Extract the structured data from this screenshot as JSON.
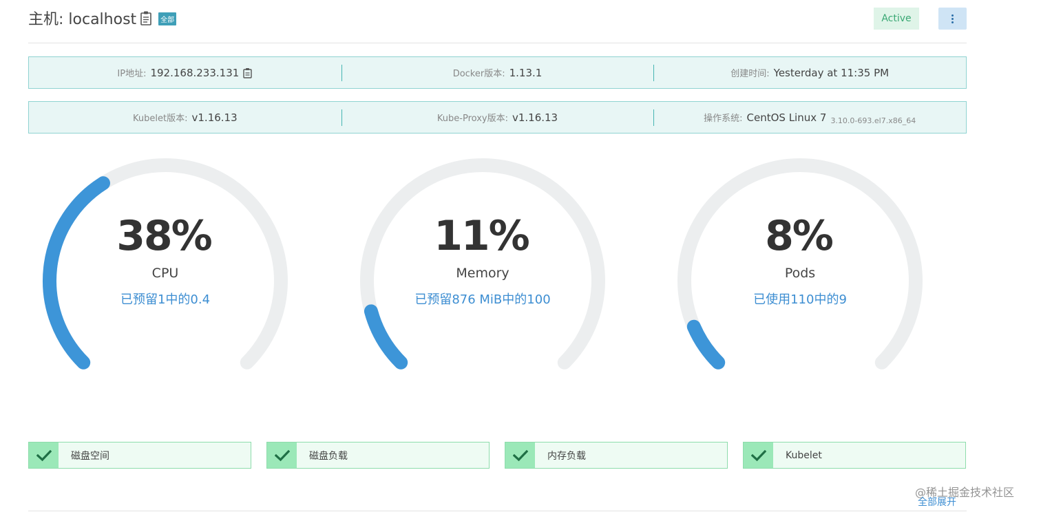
{
  "header": {
    "title": "主机: localhost",
    "scope_badge": "全部",
    "status": "Active",
    "status_color": "#3aa874",
    "more_icon": "vertical-dots-icon"
  },
  "info_rows": [
    {
      "cells": [
        {
          "label": "IP地址:",
          "value": "192.168.233.131",
          "icon": "copy-icon"
        },
        {
          "label": "Docker版本:",
          "value": "1.13.1"
        },
        {
          "label": "创建时间:",
          "value": "Yesterday at 11:35 PM"
        }
      ]
    },
    {
      "cells": [
        {
          "label": "Kubelet版本:",
          "value": "v1.16.13"
        },
        {
          "label": "Kube-Proxy版本:",
          "value": "v1.16.13"
        },
        {
          "label": "操作系统:",
          "value": "CentOS Linux 7",
          "sub": "3.10.0-693.el7.x86_64"
        }
      ]
    }
  ],
  "gauges": [
    {
      "percent_text": "38%",
      "percent": 38,
      "label": "CPU",
      "sub": "已预留1中的0.4"
    },
    {
      "percent_text": "11%",
      "percent": 11,
      "label": "Memory",
      "sub": "已预留876 MiB中的100"
    },
    {
      "percent_text": "8%",
      "percent": 8,
      "label": "Pods",
      "sub": "已使用110中的9"
    }
  ],
  "gauge_colors": {
    "track": "#eceeef",
    "fill": "#3d95d8"
  },
  "health_checks": [
    {
      "label": "磁盘空间",
      "icon": "check-icon"
    },
    {
      "label": "磁盘负载",
      "icon": "check-icon"
    },
    {
      "label": "内存负载",
      "icon": "check-icon"
    },
    {
      "label": "Kubelet",
      "icon": "check-icon"
    }
  ],
  "footer": {
    "expand_all": "全部展开",
    "watermark": "@稀土掘金技术社区"
  }
}
